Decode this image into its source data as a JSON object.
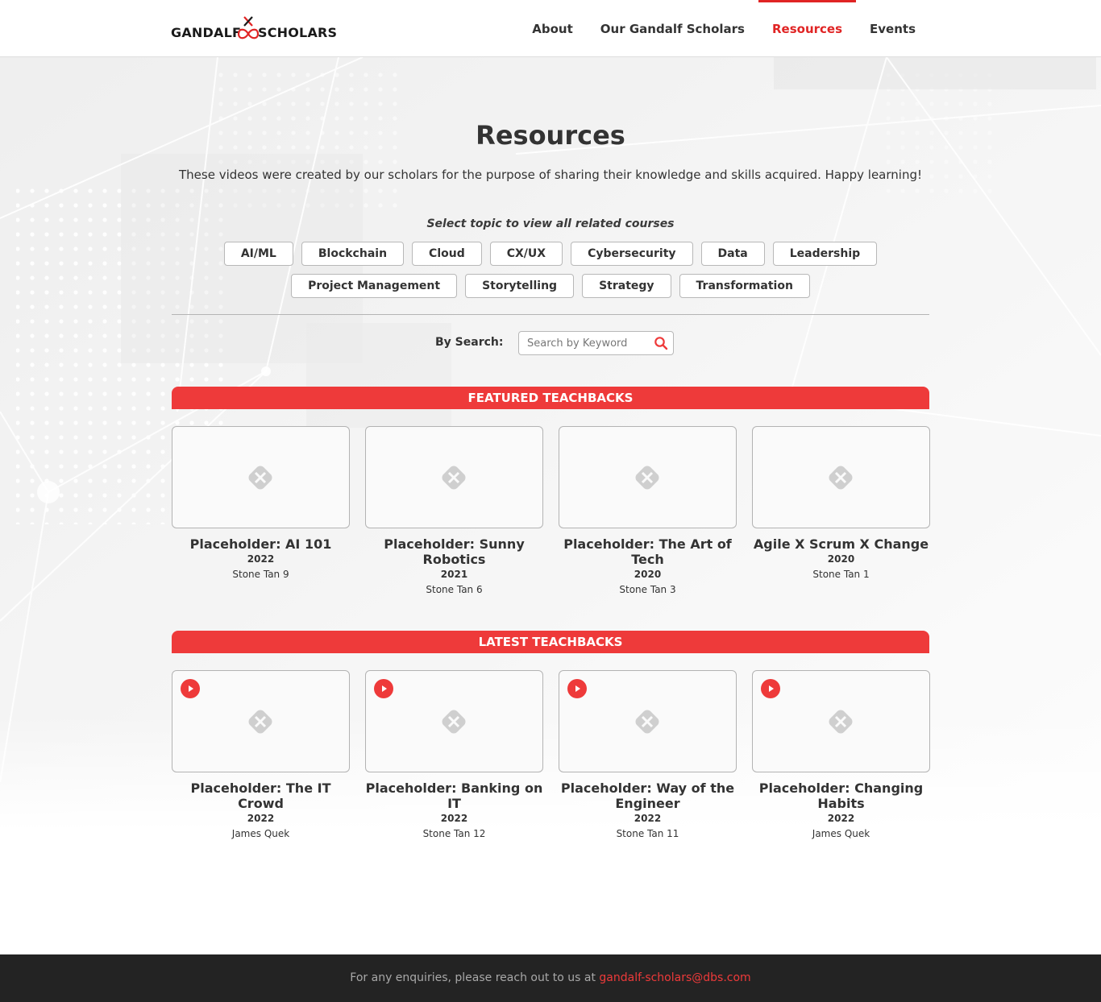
{
  "header": {
    "logo_left": "GANDALF",
    "logo_right": "SCHOLARS",
    "nav": [
      "About",
      "Our Gandalf Scholars",
      "Resources",
      "Events"
    ],
    "active_nav": "Resources"
  },
  "main": {
    "title": "Resources",
    "intro": "These videos were created by our scholars for the purpose of sharing their knowledge and skills acquired. Happy learning!",
    "topic_prompt": "Select topic to view all related courses",
    "topics_row1": [
      "AI/ML",
      "Blockchain",
      "Cloud",
      "CX/UX",
      "Cybersecurity",
      "Data",
      "Leadership"
    ],
    "topics_row2": [
      "Project Management",
      "Storytelling",
      "Strategy",
      "Transformation"
    ],
    "search": {
      "label": "By Search:",
      "placeholder": "Search by Keyword",
      "value": ""
    }
  },
  "featured": {
    "heading": "FEATURED TEACHBACKS",
    "cards": [
      {
        "title": "Placeholder: AI 101",
        "year": "2022",
        "author": "Stone Tan 9"
      },
      {
        "title": "Placeholder: Sunny Robotics",
        "year": "2021",
        "author": "Stone Tan 6"
      },
      {
        "title": "Placeholder: The Art of Tech",
        "year": "2020",
        "author": "Stone Tan 3"
      },
      {
        "title": "Agile X Scrum X Change",
        "year": "2020",
        "author": "Stone Tan 1"
      }
    ]
  },
  "latest": {
    "heading": "LATEST TEACHBACKS",
    "cards": [
      {
        "title": "Placeholder: The IT Crowd",
        "year": "2022",
        "author": "James Quek"
      },
      {
        "title": "Placeholder: Banking on IT",
        "year": "2022",
        "author": "Stone Tan 12"
      },
      {
        "title": "Placeholder: Way of the Engineer",
        "year": "2022",
        "author": "Stone Tan 11"
      },
      {
        "title": "Placeholder: Changing Habits",
        "year": "2022",
        "author": "James Quek"
      }
    ]
  },
  "footer": {
    "text": "For any enquiries, please reach out to us at",
    "email": "gandalf-scholars@dbs.com"
  },
  "colors": {
    "accent": "#ee3a3a",
    "nav_active": "#e02424",
    "footer_bg": "#232323",
    "text": "#333333"
  },
  "icons": {
    "search": "search-icon",
    "image_placeholder": "broken-image-icon",
    "play": "play-icon"
  }
}
